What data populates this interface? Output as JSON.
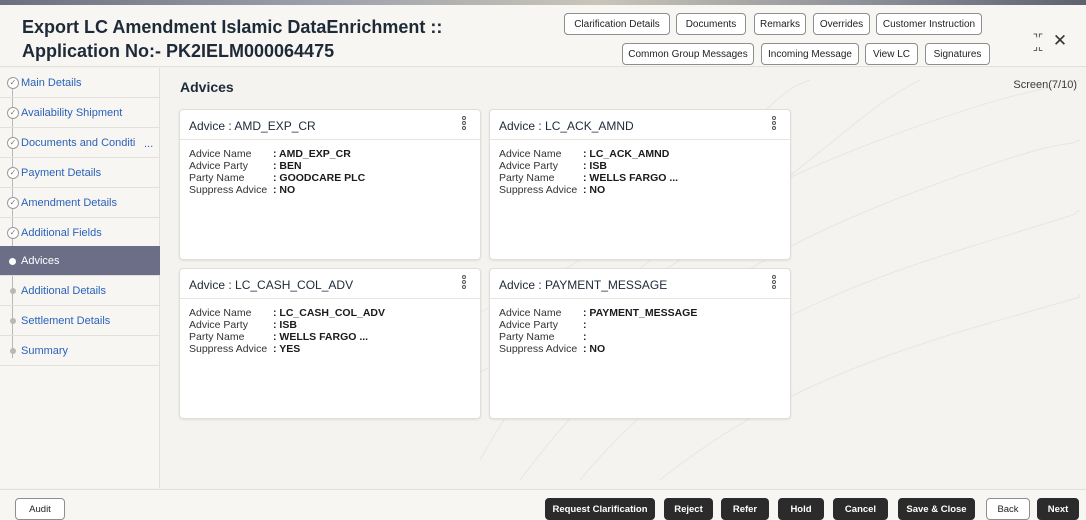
{
  "header": {
    "title_line1": "Export LC Amendment Islamic DataEnrichment ::",
    "title_line2": "Application No:- PK2IELM000064475",
    "buttons_row1": [
      "Clarification Details",
      "Documents",
      "Remarks",
      "Overrides",
      "Customer Instruction"
    ],
    "buttons_row2": [
      "Common Group Messages",
      "Incoming Message",
      "View LC",
      "Signatures"
    ],
    "expand_icon": "expand-icon",
    "close_icon": "close-icon"
  },
  "sidebar": {
    "items": [
      {
        "label": "Main Details",
        "state": "done"
      },
      {
        "label": "Availability Shipment",
        "state": "done"
      },
      {
        "label": "Documents and Conditi",
        "state": "done"
      },
      {
        "label": "Payment Details",
        "state": "done"
      },
      {
        "label": "Amendment Details",
        "state": "done"
      },
      {
        "label": "Additional Fields",
        "state": "done"
      },
      {
        "label": "Advices",
        "state": "active"
      },
      {
        "label": "Additional Details",
        "state": "pending"
      },
      {
        "label": "Settlement Details",
        "state": "pending"
      },
      {
        "label": "Summary",
        "state": "pending"
      }
    ],
    "overflow_ellipsis": "..."
  },
  "main": {
    "title": "Advices",
    "screen_info": "Screen(7/10)",
    "field_labels": [
      "Advice Name",
      "Advice Party",
      "Party Name",
      "Suppress Advice"
    ],
    "cards": [
      {
        "title": "Advice : AMD_EXP_CR",
        "values": [
          ": AMD_EXP_CR",
          ": BEN",
          ": GOODCARE PLC",
          ": NO"
        ]
      },
      {
        "title": "Advice : LC_ACK_AMND",
        "values": [
          ": LC_ACK_AMND",
          ": ISB",
          ": WELLS FARGO ...",
          ": NO"
        ]
      },
      {
        "title": "Advice : LC_CASH_COL_ADV",
        "values": [
          ": LC_CASH_COL_ADV",
          ": ISB",
          ": WELLS FARGO ...",
          ": YES"
        ]
      },
      {
        "title": "Advice : PAYMENT_MESSAGE",
        "values": [
          ": PAYMENT_MESSAGE",
          ":",
          ":",
          ": NO"
        ]
      }
    ]
  },
  "footer": {
    "audit": "Audit",
    "actions": [
      "Request Clarification",
      "Reject",
      "Refer",
      "Hold",
      "Cancel",
      "Save & Close"
    ],
    "back": "Back",
    "next": "Next"
  }
}
